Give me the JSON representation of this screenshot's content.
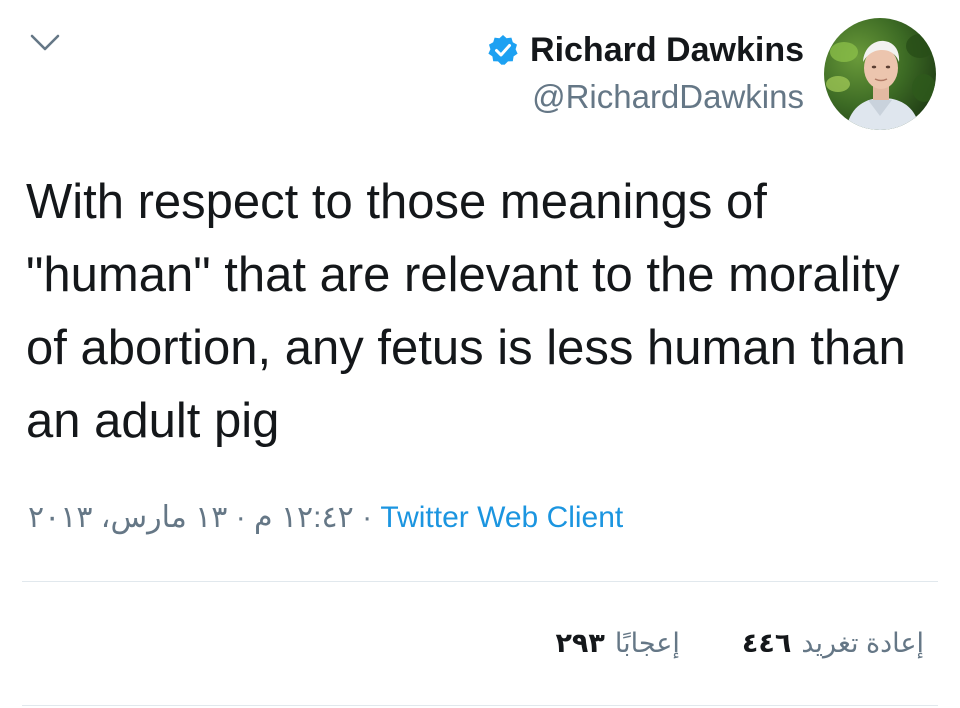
{
  "header": {
    "display_name": "Richard Dawkins",
    "handle": "@RichardDawkins",
    "verified": true
  },
  "icons": {
    "back": "chevron-down-icon",
    "verified": "verified-badge-icon",
    "avatar": "profile-photo"
  },
  "tweet": {
    "text": "With respect to those meanings of \"human\" that are relevant to the morality of abortion, any fetus is less human than an adult pig"
  },
  "meta": {
    "datetime": "١٢:٤٢ م · ١٣ مارس، ٢٠١٣",
    "separator": " · ",
    "client": "Twitter Web Client"
  },
  "stats": {
    "retweets_label": "إعادة تغريد",
    "retweets_count": "٤٤٦",
    "likes_label": "إعجابًا",
    "likes_count": "٢٩٣"
  },
  "colors": {
    "text": "#14171a",
    "secondary": "#657786",
    "link": "#1b95e0",
    "verified": "#1da1f2",
    "divider": "#e1e8ed"
  }
}
